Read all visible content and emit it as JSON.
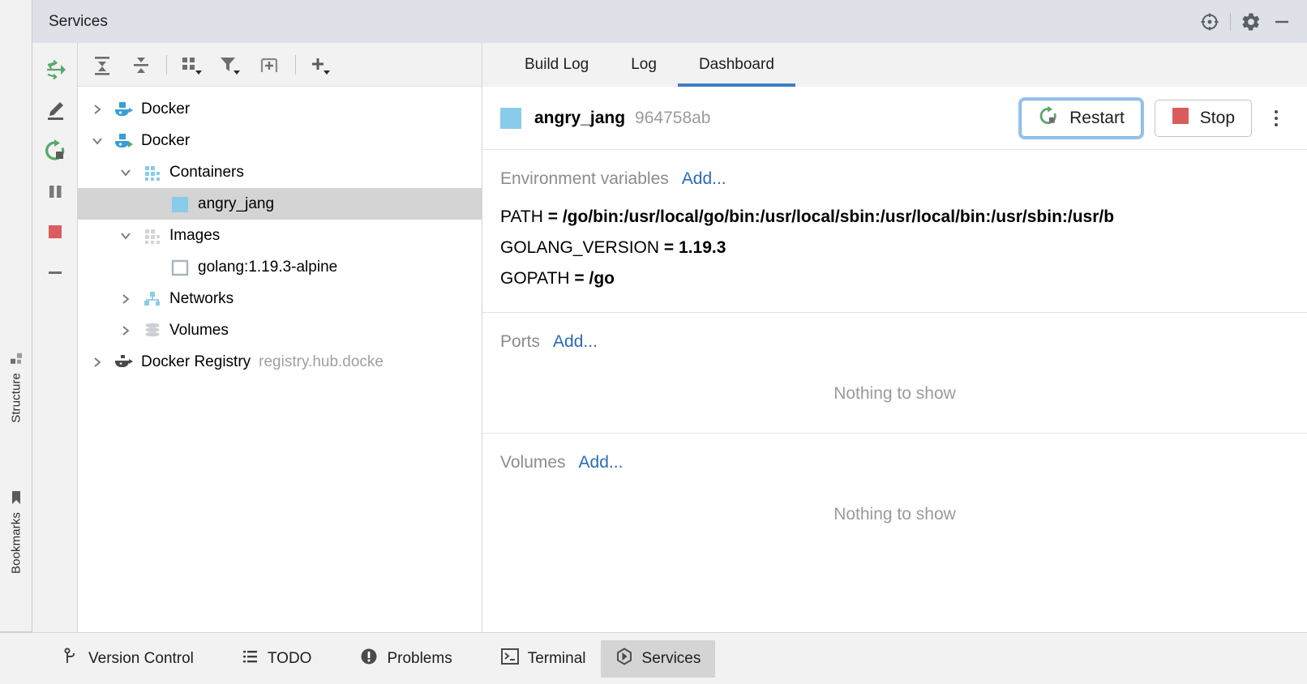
{
  "window": {
    "title": "Services",
    "header_actions": [
      {
        "name": "target-icon",
        "label": "Show Services Tool Window Settings"
      },
      {
        "name": "gear-icon",
        "label": "Settings"
      },
      {
        "name": "minimize-icon",
        "label": "Hide"
      }
    ]
  },
  "left_strip": {
    "items": [
      {
        "label": "Structure",
        "icon": "structure-icon"
      },
      {
        "label": "Bookmarks",
        "icon": "bookmark-icon"
      }
    ]
  },
  "run_toolbar": {
    "buttons": [
      {
        "name": "attach-icon",
        "label": "Attach"
      },
      {
        "name": "edit-icon",
        "label": "Edit Configuration"
      },
      {
        "name": "rerun-icon",
        "label": "Rerun"
      },
      {
        "name": "pause-icon",
        "label": "Pause"
      },
      {
        "name": "stop-icon",
        "label": "Stop"
      },
      {
        "name": "minus-icon",
        "label": "Remove"
      }
    ]
  },
  "tree_toolbar": {
    "buttons": [
      {
        "name": "expand-all-icon",
        "label": "Expand All"
      },
      {
        "name": "collapse-all-icon",
        "label": "Collapse All"
      },
      {
        "name": "group-by-icon",
        "label": "Group By"
      },
      {
        "name": "filter-icon",
        "label": "Filter"
      },
      {
        "name": "add-tab-icon",
        "label": "Add Tab"
      },
      {
        "name": "add-icon",
        "label": "Add Service"
      }
    ]
  },
  "tree": {
    "nodes": [
      {
        "label": "Docker",
        "sub": "",
        "icon": "docker-icon",
        "arrow": "right",
        "indent": 0,
        "selected": false
      },
      {
        "label": "Docker",
        "sub": "",
        "icon": "docker-connected-icon",
        "arrow": "down",
        "indent": 0,
        "selected": false
      },
      {
        "label": "Containers",
        "sub": "",
        "icon": "containers-icon",
        "arrow": "down",
        "indent": 1,
        "selected": false
      },
      {
        "label": "angry_jang",
        "sub": "",
        "icon": "container-running-icon",
        "arrow": "none",
        "indent": 2,
        "selected": true
      },
      {
        "label": "Images",
        "sub": "",
        "icon": "images-icon",
        "arrow": "down",
        "indent": 1,
        "selected": false
      },
      {
        "label": "golang:1.19.3-alpine",
        "sub": "",
        "icon": "image-icon",
        "arrow": "none",
        "indent": 2,
        "selected": false
      },
      {
        "label": "Networks",
        "sub": "",
        "icon": "networks-icon",
        "arrow": "right",
        "indent": 1,
        "selected": false
      },
      {
        "label": "Volumes",
        "sub": "",
        "icon": "volumes-icon",
        "arrow": "right",
        "indent": 1,
        "selected": false
      },
      {
        "label": "Docker Registry",
        "sub": "registry.hub.docke",
        "icon": "registry-icon",
        "arrow": "right",
        "indent": 0,
        "selected": false
      }
    ]
  },
  "detail": {
    "tabs": [
      {
        "label": "Build Log",
        "active": false
      },
      {
        "label": "Log",
        "active": false
      },
      {
        "label": "Dashboard",
        "active": true
      }
    ],
    "container": {
      "name": "angry_jang",
      "hash": "964758ab",
      "status_color": "#89ccea",
      "restart_label": "Restart",
      "stop_label": "Stop",
      "more_label": "More"
    },
    "sections": {
      "env": {
        "title": "Environment variables",
        "add_label": "Add...",
        "rows": [
          {
            "key": "PATH",
            "value": "/go/bin:/usr/local/go/bin:/usr/local/sbin:/usr/local/bin:/usr/sbin:/usr/b"
          },
          {
            "key": "GOLANG_VERSION",
            "value": "1.19.3"
          },
          {
            "key": "GOPATH",
            "value": "/go"
          }
        ]
      },
      "ports": {
        "title": "Ports",
        "add_label": "Add...",
        "empty_label": "Nothing to show"
      },
      "volumes": {
        "title": "Volumes",
        "add_label": "Add...",
        "empty_label": "Nothing to show"
      }
    }
  },
  "statusbar": {
    "items": [
      {
        "label": "Version Control",
        "icon": "branch-icon",
        "active": false
      },
      {
        "label": "TODO",
        "icon": "list-icon",
        "active": false
      },
      {
        "label": "Problems",
        "icon": "warning-icon",
        "active": false
      },
      {
        "label": "Terminal",
        "icon": "terminal-icon",
        "active": false
      },
      {
        "label": "Services",
        "icon": "services-icon",
        "active": true
      }
    ]
  },
  "colors": {
    "accent_blue": "#3e7fc1",
    "link_blue": "#2a6bb5",
    "header_bg": "#dfe1e8",
    "selection": "#d4d4d4",
    "green": "#59a869",
    "red": "#db5c5c",
    "docker_blue": "#389fd6"
  }
}
